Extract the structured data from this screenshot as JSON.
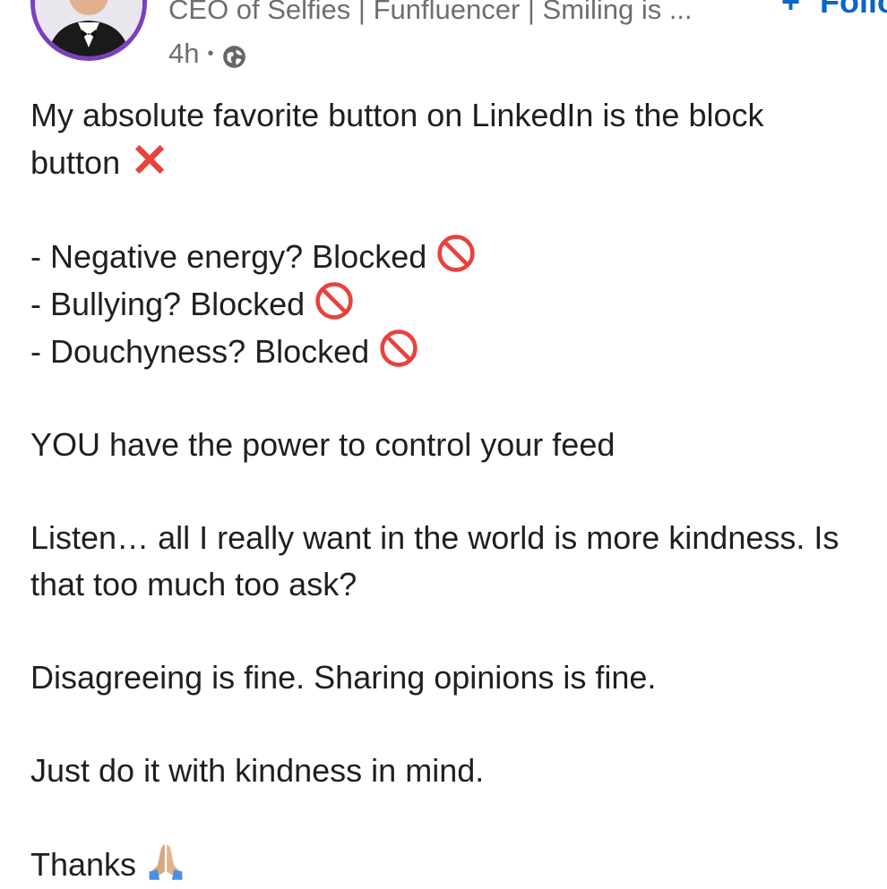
{
  "author": {
    "headline": "CEO of Selfies | Funfluencer | Smiling is ...",
    "time": "4h",
    "separator": "•",
    "visibility_icon": "globe-icon"
  },
  "follow": {
    "plus": "+",
    "label": "Follow"
  },
  "post": {
    "line1": "My absolute favorite button on LinkedIn is the block",
    "line2": "button",
    "line2_emoji": "cross-mark-emoji",
    "bullet1": "- Negative energy? Blocked",
    "bullet2": "- Bullying? Blocked",
    "bullet3": "- Douchyness? Blocked",
    "bullet_emoji": "prohibited-emoji",
    "power": "YOU have the power to control your feed",
    "listen1": "Listen… all I really want in the world is more kindness. Is",
    "listen2": "that too much too ask?",
    "disagree": "Disagreeing is fine. Sharing opinions is fine.",
    "kindness": "Just do it with kindness in mind.",
    "thanks": "Thanks",
    "thanks_emoji": "folded-hands-emoji"
  },
  "colors": {
    "accent": "#0a66c2",
    "muted": "#6e6e6e",
    "text": "#1f1f1f",
    "avatar_ring": "#7b3fbf",
    "cross": "#e8423d"
  }
}
